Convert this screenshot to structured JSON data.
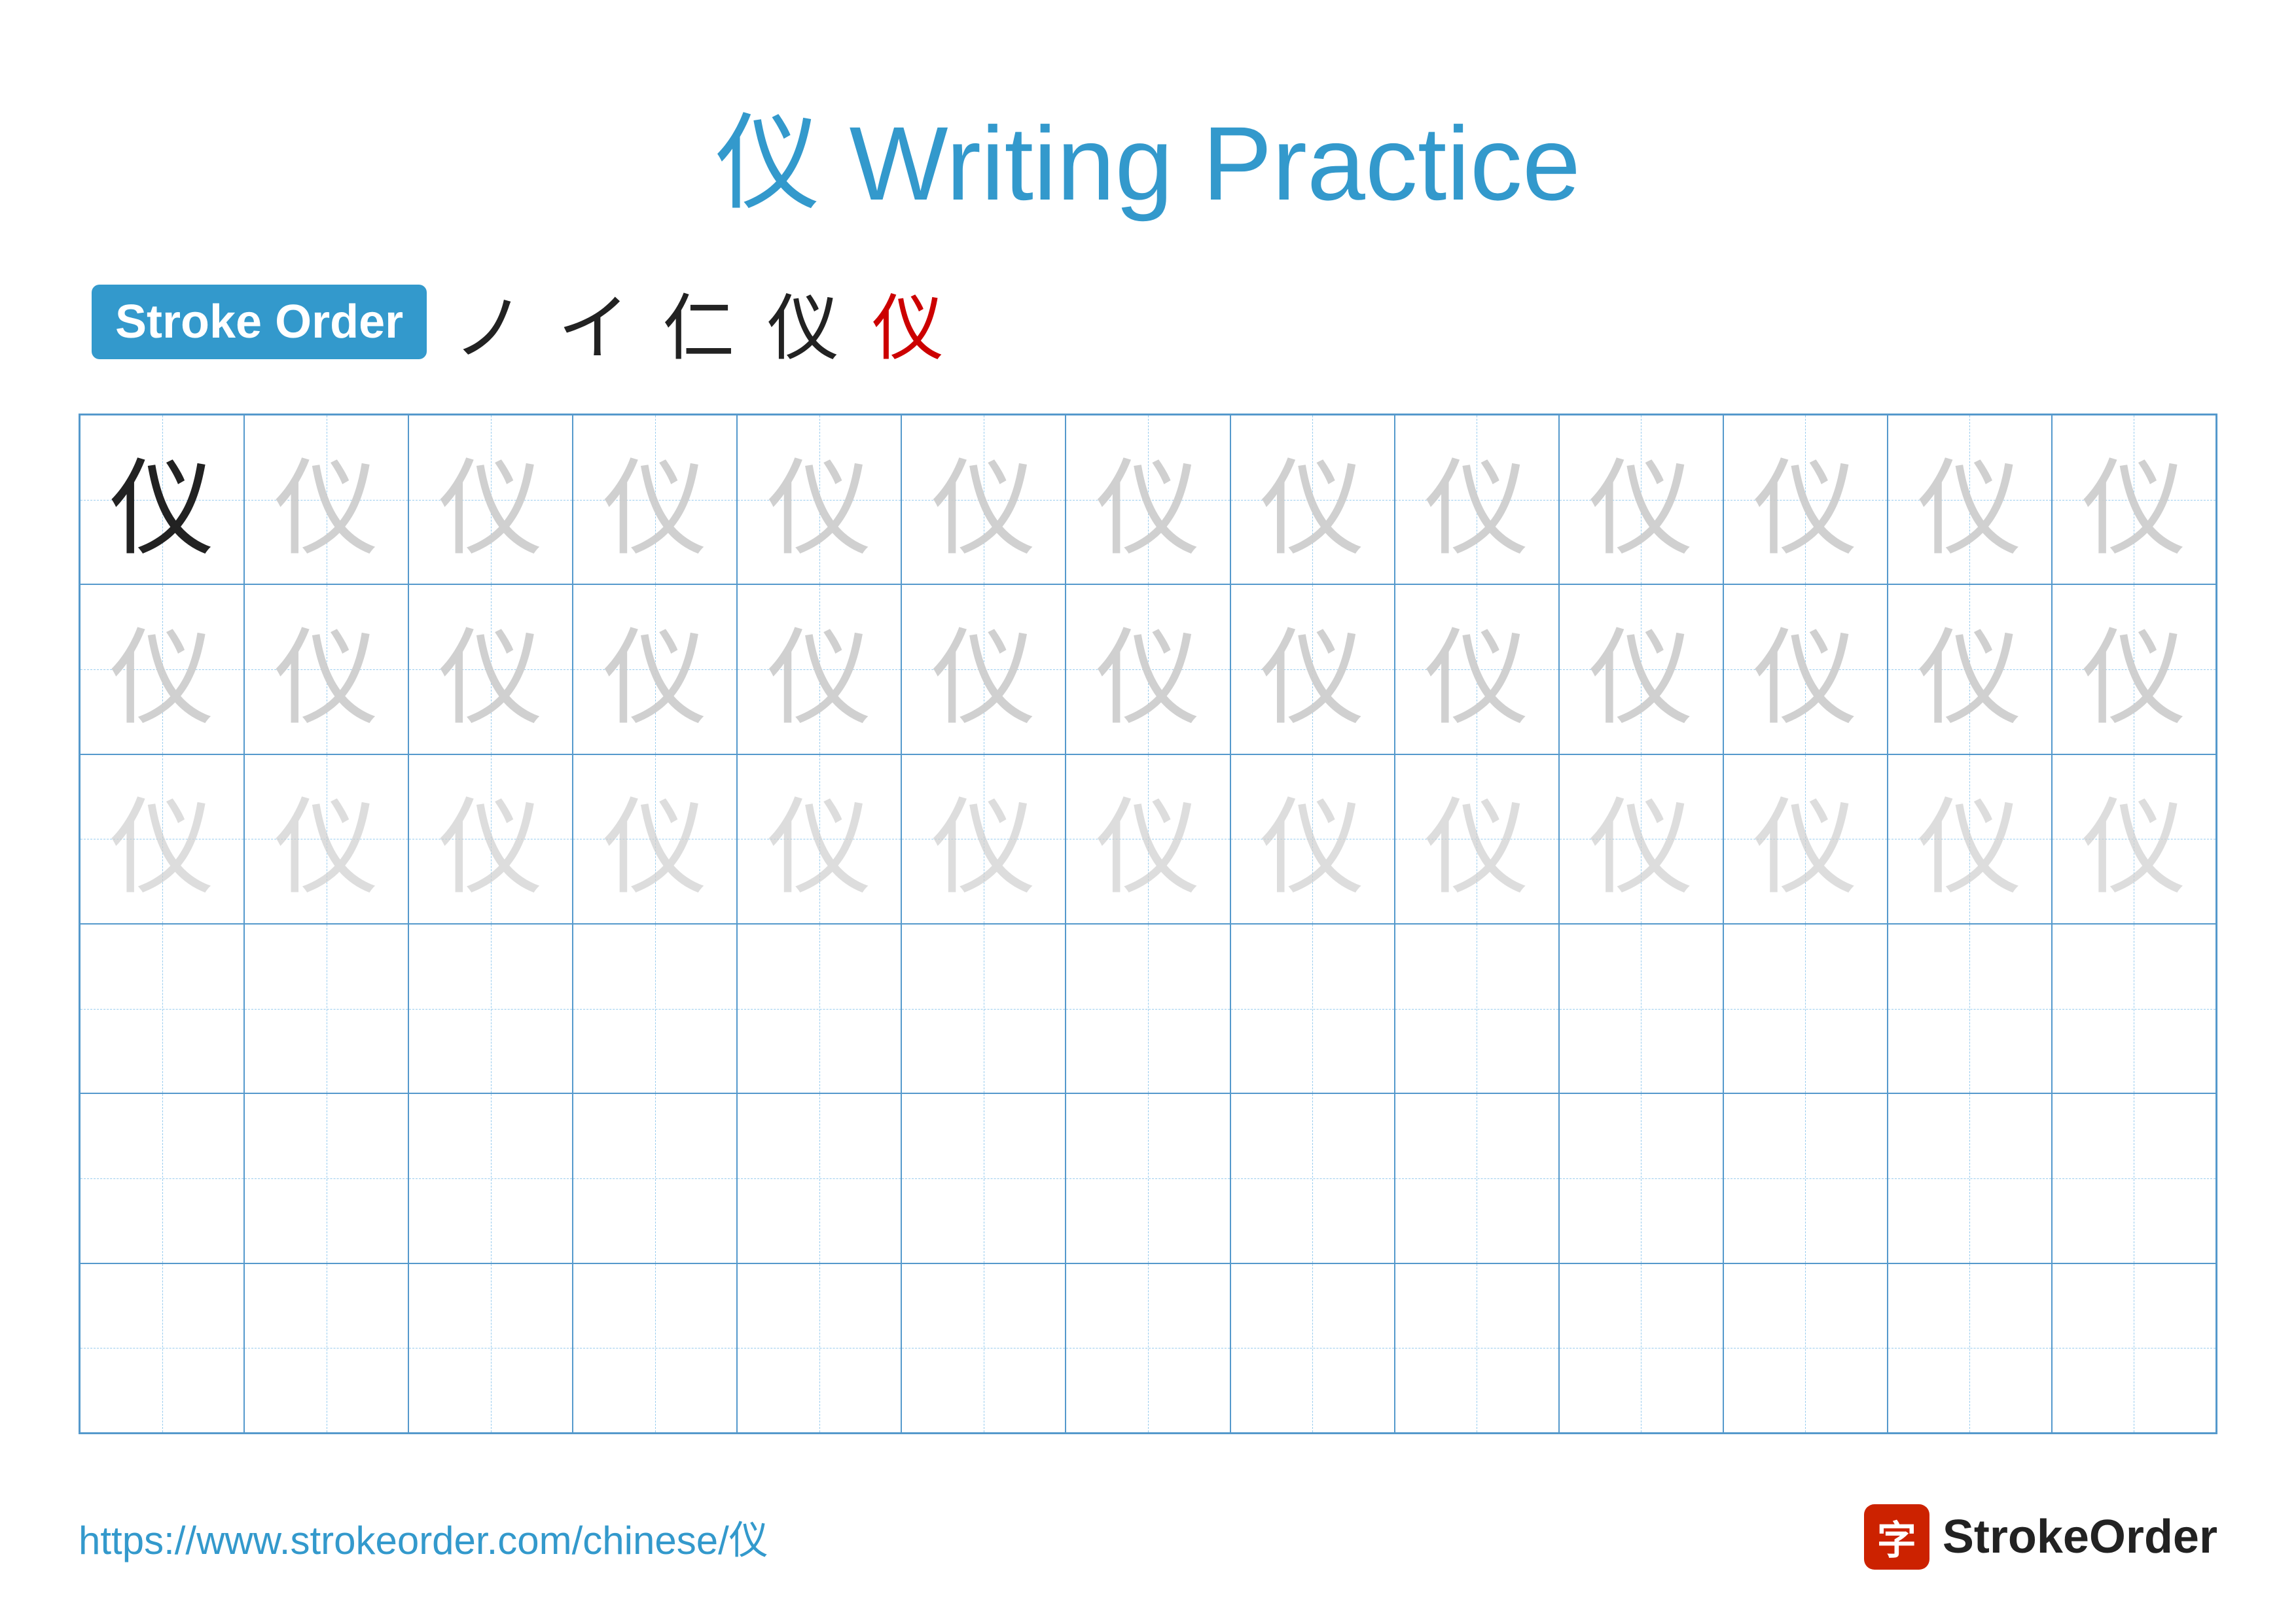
{
  "title": {
    "char": "仪",
    "text": " Writing Practice"
  },
  "stroke_order": {
    "badge_label": "Stroke Order",
    "steps": [
      "ノ",
      "イ",
      "仁",
      "仪",
      "仪"
    ]
  },
  "grid": {
    "rows": 6,
    "cols": 13,
    "character": "仪",
    "row_patterns": [
      [
        "solid",
        "light1",
        "light1",
        "light1",
        "light1",
        "light1",
        "light1",
        "light1",
        "light1",
        "light1",
        "light1",
        "light1",
        "light1"
      ],
      [
        "light1",
        "light1",
        "light1",
        "light1",
        "light1",
        "light1",
        "light1",
        "light1",
        "light1",
        "light1",
        "light1",
        "light1",
        "light1"
      ],
      [
        "light2",
        "light2",
        "light2",
        "light2",
        "light2",
        "light2",
        "light2",
        "light2",
        "light2",
        "light2",
        "light2",
        "light2",
        "light2"
      ],
      [
        "empty",
        "empty",
        "empty",
        "empty",
        "empty",
        "empty",
        "empty",
        "empty",
        "empty",
        "empty",
        "empty",
        "empty",
        "empty"
      ],
      [
        "empty",
        "empty",
        "empty",
        "empty",
        "empty",
        "empty",
        "empty",
        "empty",
        "empty",
        "empty",
        "empty",
        "empty",
        "empty"
      ],
      [
        "empty",
        "empty",
        "empty",
        "empty",
        "empty",
        "empty",
        "empty",
        "empty",
        "empty",
        "empty",
        "empty",
        "empty",
        "empty"
      ]
    ]
  },
  "footer": {
    "url": "https://www.strokeorder.com/chinese/仪",
    "logo_text": "StrokeOrder",
    "logo_icon": "字"
  }
}
